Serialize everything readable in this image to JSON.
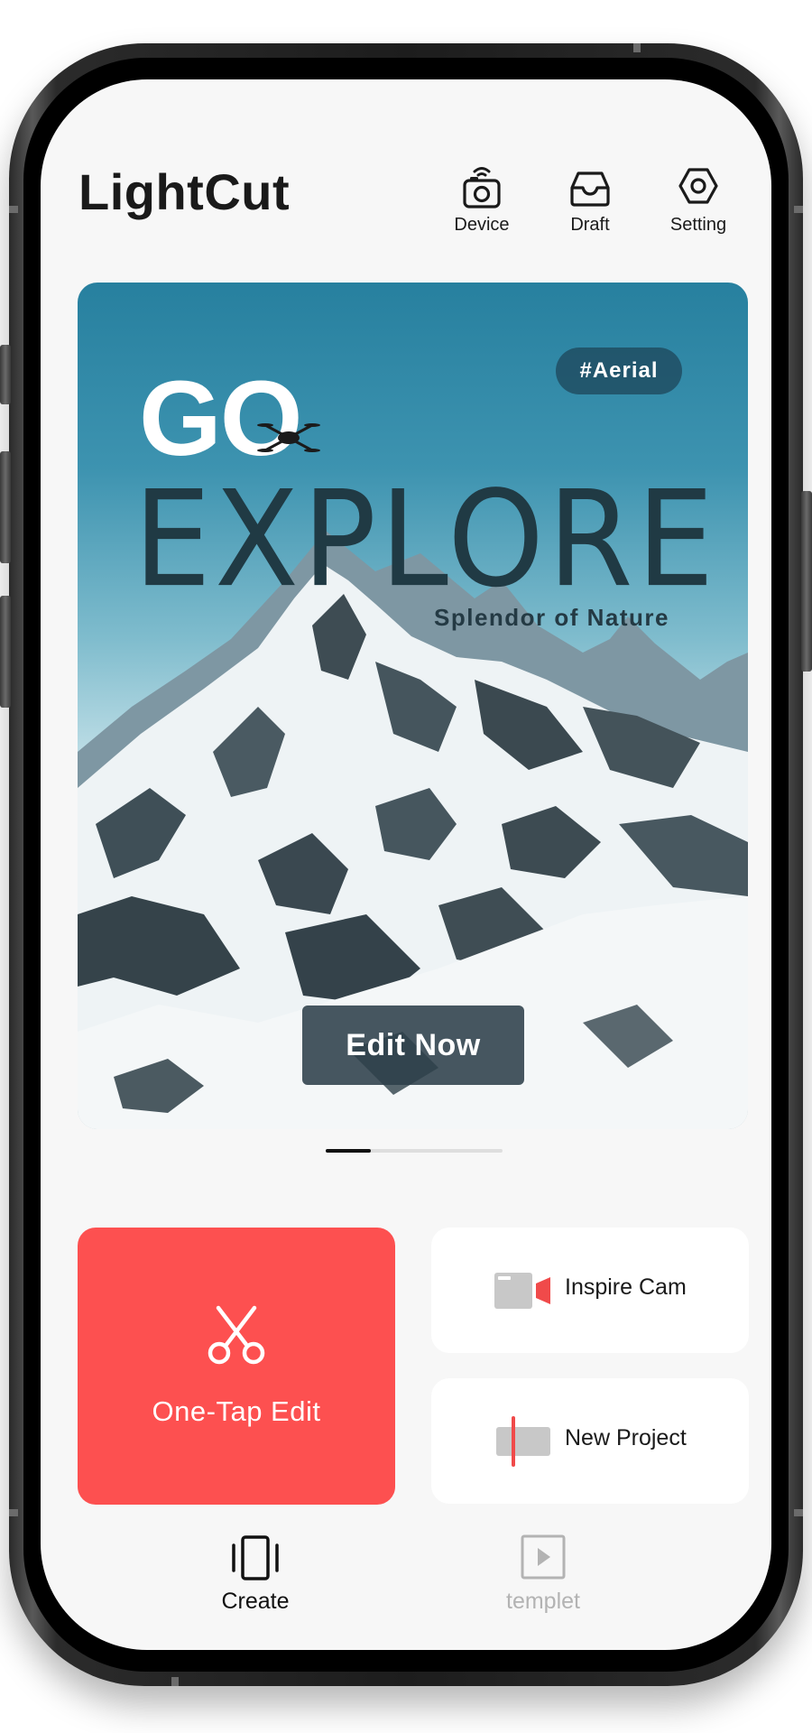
{
  "app": {
    "title": "LightCut"
  },
  "header": {
    "actions": [
      {
        "label": "Device",
        "icon": "camera-device-icon"
      },
      {
        "label": "Draft",
        "icon": "inbox-tray-icon"
      },
      {
        "label": "Setting",
        "icon": "hexagon-settings-icon"
      }
    ]
  },
  "banner": {
    "tag": "#Aerial",
    "headline_top": "GO",
    "headline_main": "EXPLORE",
    "subtitle": "Splendor of Nature",
    "cta": "Edit Now",
    "page_index": 1
  },
  "actions": {
    "one_tap": {
      "label": "One-Tap Edit",
      "icon": "scissors-icon",
      "color": "#fd5050"
    },
    "inspire_cam": {
      "label": "Inspire Cam",
      "icon": "video-camera-icon",
      "accent": "#f04a4a"
    },
    "new_project": {
      "label": "New Project",
      "icon": "timeline-clip-icon",
      "accent": "#f04a4a"
    }
  },
  "bottom_nav": {
    "items": [
      {
        "label": "Create",
        "icon": "create-frame-icon",
        "active": true
      },
      {
        "label": "templet",
        "icon": "play-square-icon",
        "active": false
      }
    ],
    "active_color": "#111111",
    "inactive_color": "#b3b3b3"
  }
}
